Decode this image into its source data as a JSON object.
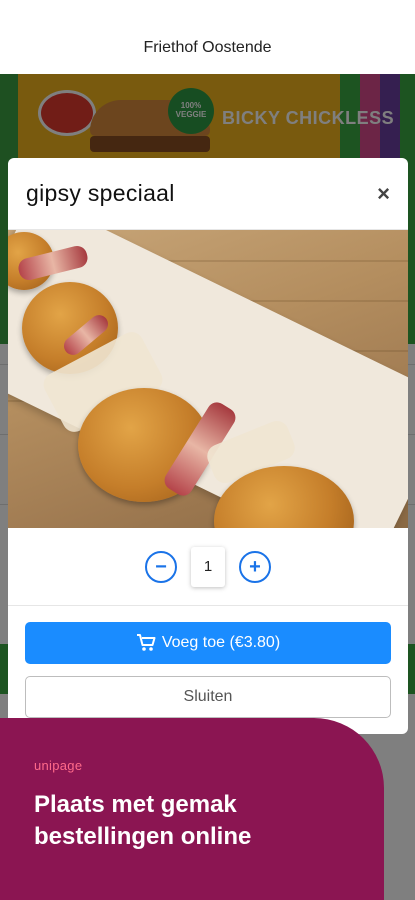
{
  "header": {
    "title": "Friethof Oostende"
  },
  "banner": {
    "veggie_label": "100% VEGGIE",
    "product_label": "BICKY CHICKLESS"
  },
  "modal": {
    "title": "gipsy speciaal",
    "close_symbol": "×",
    "quantity": "1",
    "minus_symbol": "−",
    "plus_symbol": "+",
    "add_button": "Voeg toe (€3.80)",
    "close_button": "Sluiten"
  },
  "promo": {
    "brand": "unipage",
    "headline": "Plaats met gemak bestellingen online"
  },
  "colors": {
    "primary": "#1a8cff",
    "promo_bg": "#8b1552",
    "promo_brand": "#ff6a8a"
  },
  "icons": {
    "cart": "cart-icon",
    "close": "close-icon",
    "minus": "minus-icon",
    "plus": "plus-icon"
  }
}
